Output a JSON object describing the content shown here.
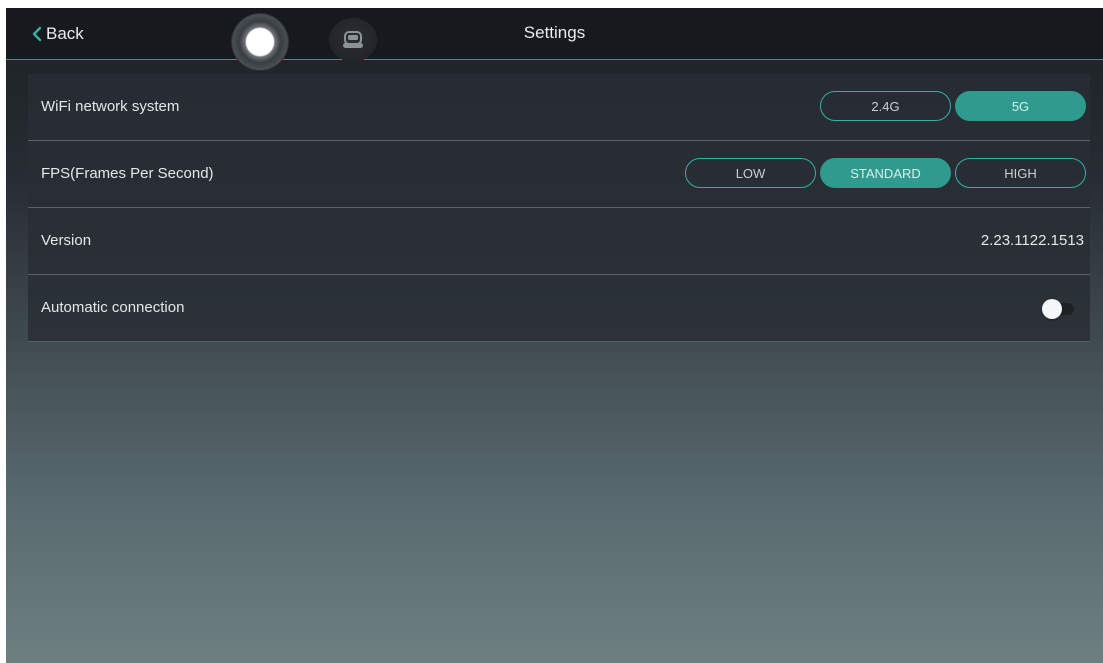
{
  "header": {
    "back_label": "Back",
    "title": "Settings",
    "camera_icon": "shutter-circle-icon",
    "robot_icon": "robot-car-icon"
  },
  "settings": {
    "wifi": {
      "label": "WiFi network system",
      "options": [
        "2.4G",
        "5G"
      ],
      "selected": "5G"
    },
    "fps": {
      "label": "FPS(Frames Per Second)",
      "options": [
        "LOW",
        "STANDARD",
        "HIGH"
      ],
      "selected": "STANDARD"
    },
    "version": {
      "label": "Version",
      "value": "2.23.1122.1513"
    },
    "auto_connect": {
      "label": "Automatic connection",
      "enabled": false
    }
  },
  "colors": {
    "accent": "#2f9a8e",
    "accent_border": "#2fb3a4",
    "topbar": "#16191d"
  }
}
